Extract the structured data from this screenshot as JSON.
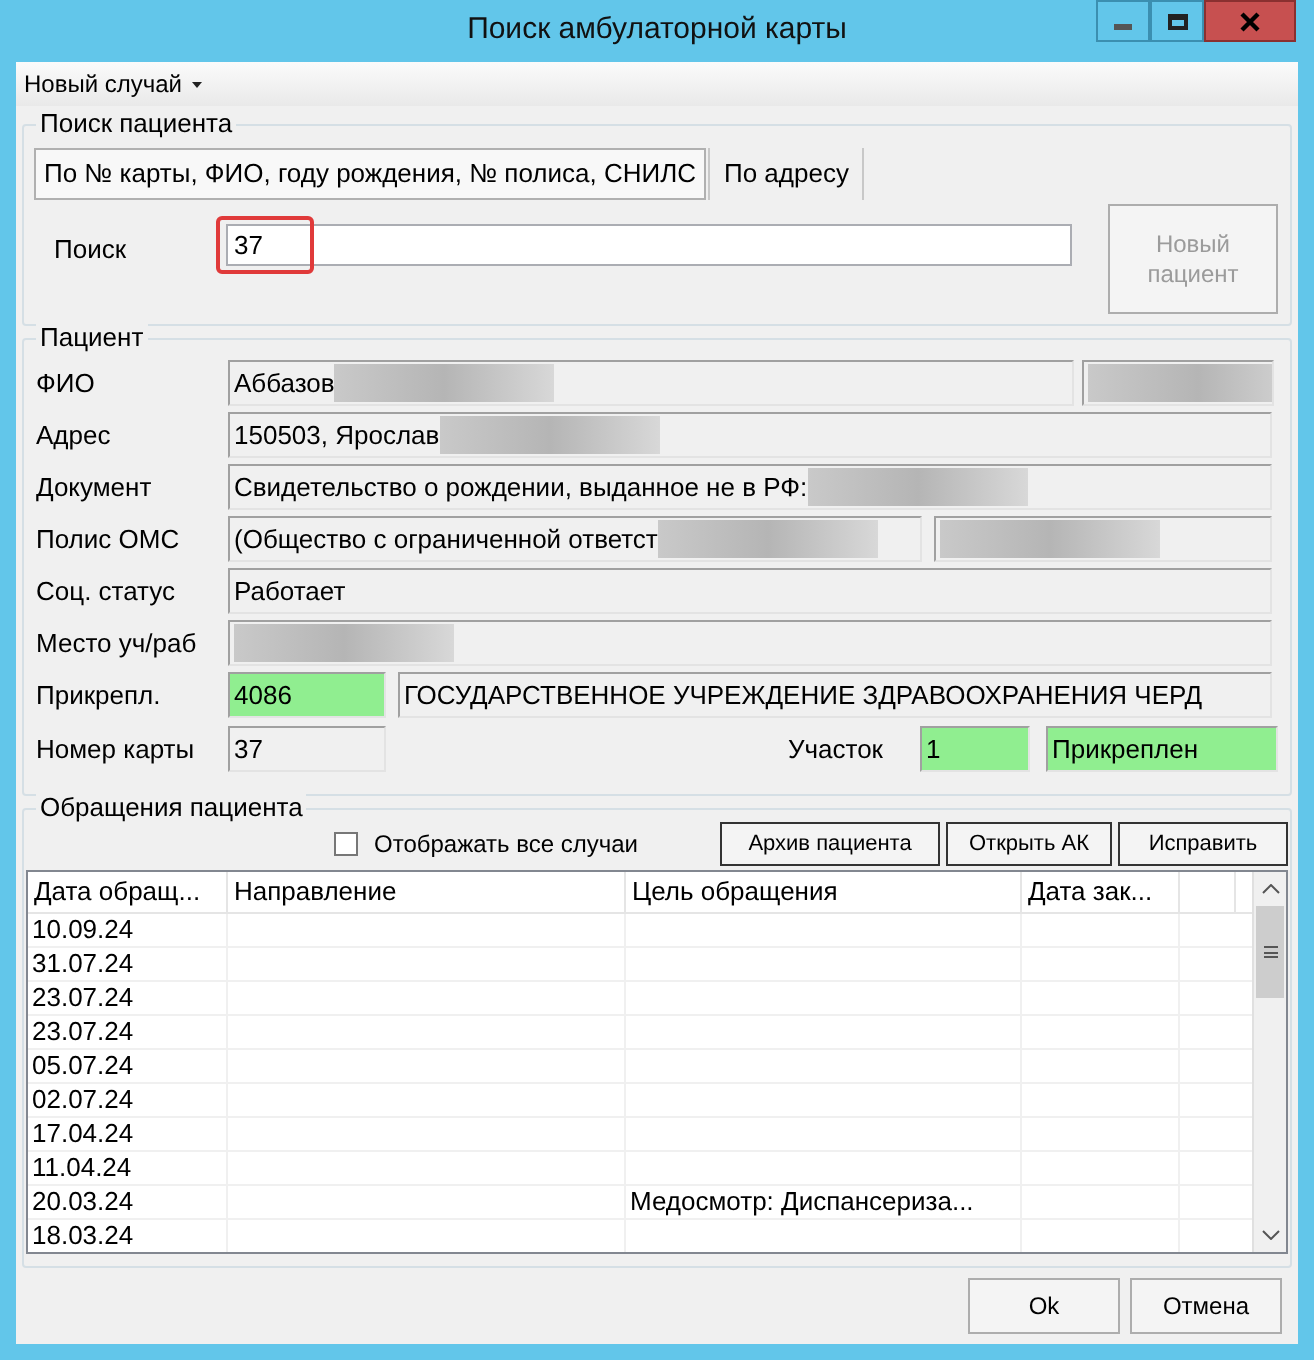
{
  "window": {
    "title": "Поиск амбулаторной карты"
  },
  "menu": {
    "label": "Новый случай"
  },
  "search_group": {
    "title": "Поиск пациента",
    "tabs": [
      {
        "label": "По № карты, ФИО, году рождения, № полиса, СНИЛС",
        "selected": true
      },
      {
        "label": "По адресу",
        "selected": false
      }
    ],
    "search": {
      "label": "Поиск",
      "value": "37",
      "highlighted": true
    },
    "new_patient_button": {
      "label": "Новый пациент",
      "disabled": true
    }
  },
  "patient": {
    "title": "Пациент",
    "rows": [
      {
        "kind": "name",
        "label": "ФИО",
        "boxes": [
          {
            "value": "Аббазов",
            "redacted": true
          },
          {
            "redacted": true
          }
        ]
      },
      {
        "kind": "wide",
        "label": "Адрес",
        "boxes": [
          {
            "value": "150503, Ярослав",
            "redacted": true
          }
        ]
      },
      {
        "kind": "wide",
        "label": "Документ",
        "boxes": [
          {
            "value": "Свидетельство о рождении, выданное не в РФ:",
            "redacted": true
          }
        ]
      },
      {
        "kind": "split",
        "label": "Полис ОМС",
        "boxes": [
          {
            "value": "(Общество с ограниченной ответст",
            "redacted": true
          },
          {
            "redacted": true
          }
        ]
      },
      {
        "kind": "wide",
        "label": "Соц. статус",
        "boxes": [
          {
            "value": "Работает",
            "redacted": false
          }
        ]
      },
      {
        "kind": "wide",
        "label": "Место уч/раб",
        "boxes": [
          {
            "redacted": true
          }
        ]
      },
      {
        "kind": "code",
        "label": "Прикрепл.",
        "boxes": [
          {
            "value": "4086",
            "highlighted": true
          },
          {
            "value": "ГОСУДАРСТВЕННОЕ УЧРЕЖДЕНИЕ ЗДРАВООХРАНЕНИЯ ЧЕРД",
            "highlighted": false
          }
        ]
      }
    ],
    "card": {
      "label": "Номер карты",
      "value": "37",
      "district_label": "Участок",
      "district": {
        "value": "1",
        "highlighted": true
      },
      "status": {
        "value": "Прикреплен",
        "highlighted": true
      }
    }
  },
  "visits": {
    "title": "Обращения пациента",
    "show_all": {
      "label": "Отображать все случаи",
      "checked": false
    },
    "buttons": [
      "Архив пациента",
      "Открыть АК",
      "Исправить"
    ],
    "table": {
      "columns": [
        "Дата обращ...",
        "Направление",
        "Цель обращения",
        "Дата зак..."
      ],
      "rows": [
        [
          "10.09.24",
          "",
          "",
          ""
        ],
        [
          "31.07.24",
          "",
          "",
          ""
        ],
        [
          "23.07.24",
          "",
          "",
          ""
        ],
        [
          "23.07.24",
          "",
          "",
          ""
        ],
        [
          "05.07.24",
          "",
          "",
          ""
        ],
        [
          "02.07.24",
          "",
          "",
          ""
        ],
        [
          "17.04.24",
          "",
          "",
          ""
        ],
        [
          "11.04.24",
          "",
          "",
          ""
        ],
        [
          "20.03.24",
          "",
          "Медосмотр: Диспансериза...",
          ""
        ],
        [
          "18.03.24",
          "",
          "",
          ""
        ]
      ]
    }
  },
  "footer": {
    "buttons": [
      "Ok",
      "Отмена"
    ]
  }
}
